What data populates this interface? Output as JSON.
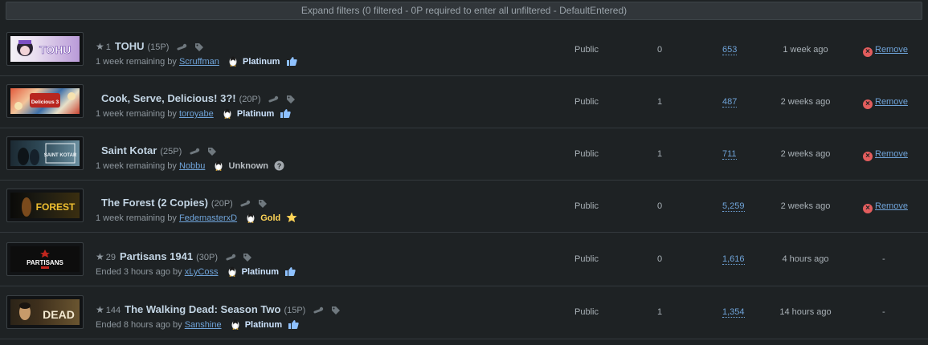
{
  "filters": {
    "label": "Expand filters (0 filtered - 0P required to enter all unfiltered - DefaultEntered)"
  },
  "rows": [
    {
      "star": "★",
      "rating": "1",
      "title": "TOHU",
      "points": "(15P)",
      "remaining": "1 week remaining by",
      "user": "Scruffman",
      "level": "Platinum",
      "visibility": "Public",
      "count": "0",
      "entries": "653",
      "time": "1 week ago",
      "action": "Remove",
      "thumb_text": "TOHU"
    },
    {
      "star": "",
      "rating": "",
      "title": "Cook, Serve, Delicious! 3?!",
      "points": "(20P)",
      "remaining": "1 week remaining by",
      "user": "toroyabe",
      "level": "Platinum",
      "visibility": "Public",
      "count": "1",
      "entries": "487",
      "time": "2 weeks ago",
      "action": "Remove",
      "thumb_text": "Delicious 3"
    },
    {
      "star": "",
      "rating": "",
      "title": "Saint Kotar",
      "points": "(25P)",
      "remaining": "1 week remaining by",
      "user": "Nobbu",
      "level": "Unknown",
      "visibility": "Public",
      "count": "1",
      "entries": "711",
      "time": "2 weeks ago",
      "action": "Remove",
      "thumb_text": "SAINT KOTAR"
    },
    {
      "star": "",
      "rating": "",
      "title": "The Forest (2 Copies)",
      "points": "(20P)",
      "remaining": "1 week remaining by",
      "user": "FedemasterxD",
      "level": "Gold",
      "visibility": "Public",
      "count": "0",
      "entries": "5,259",
      "time": "2 weeks ago",
      "action": "Remove",
      "thumb_text": "FOREST"
    },
    {
      "star": "★",
      "rating": "29",
      "title": "Partisans 1941",
      "points": "(30P)",
      "remaining": "Ended 3 hours ago by",
      "user": "xLyCoss",
      "level": "Platinum",
      "visibility": "Public",
      "count": "0",
      "entries": "1,616",
      "time": "4 hours ago",
      "action": "-",
      "thumb_text": "PARTISANS"
    },
    {
      "star": "★",
      "rating": "144",
      "title": "The Walking Dead: Season Two",
      "points": "(15P)",
      "remaining": "Ended 8 hours ago by",
      "user": "Sanshine",
      "level": "Platinum",
      "visibility": "Public",
      "count": "1",
      "entries": "1,354",
      "time": "14 hours ago",
      "action": "-",
      "thumb_text": "DEAD"
    }
  ],
  "colors": {
    "background": "#1e2224",
    "link": "#6fa3d8",
    "remove_icon": "#e35d5d",
    "platinum": "#cde4ff",
    "gold": "#ffd557"
  }
}
